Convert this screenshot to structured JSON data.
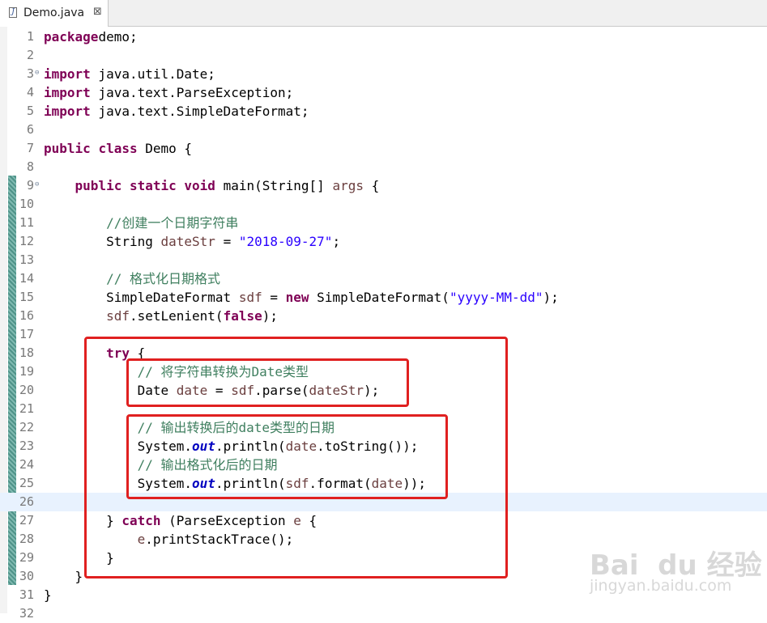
{
  "tab": {
    "filename": "Demo.java",
    "close": "⊠",
    "file_icon": "J"
  },
  "editor": {
    "current_line": 26,
    "lines": [
      {
        "n": "1",
        "fold": false,
        "t": [
          [
            "kw",
            "package"
          ],
          [
            "",
            "demo;"
          ]
        ]
      },
      {
        "n": "2",
        "fold": false,
        "t": []
      },
      {
        "n": "3",
        "fold": true,
        "t": [
          [
            "kw",
            "import"
          ],
          [
            "",
            " java.util.Date;"
          ]
        ]
      },
      {
        "n": "4",
        "fold": false,
        "t": [
          [
            "kw",
            "import"
          ],
          [
            "",
            " java.text.ParseException;"
          ]
        ]
      },
      {
        "n": "5",
        "fold": false,
        "t": [
          [
            "kw",
            "import"
          ],
          [
            "",
            " java.text.SimpleDateFormat;"
          ]
        ]
      },
      {
        "n": "6",
        "fold": false,
        "t": []
      },
      {
        "n": "7",
        "fold": false,
        "t": [
          [
            "kw",
            "public"
          ],
          [
            "",
            " "
          ],
          [
            "kw",
            "class"
          ],
          [
            "",
            " Demo {"
          ]
        ]
      },
      {
        "n": "8",
        "fold": false,
        "t": []
      },
      {
        "n": "9",
        "fold": true,
        "t": [
          [
            "",
            "    "
          ],
          [
            "kw",
            "public"
          ],
          [
            "",
            " "
          ],
          [
            "kw",
            "static"
          ],
          [
            "",
            " "
          ],
          [
            "kw",
            "void"
          ],
          [
            "",
            " main(String[] "
          ],
          [
            "prm",
            "args"
          ],
          [
            "",
            " {"
          ]
        ]
      },
      {
        "n": "10",
        "fold": false,
        "t": []
      },
      {
        "n": "11",
        "fold": false,
        "t": [
          [
            "",
            "        "
          ],
          [
            "cm",
            "//创建一个日期字符串"
          ]
        ]
      },
      {
        "n": "12",
        "fold": false,
        "t": [
          [
            "",
            "        String "
          ],
          [
            "prm",
            "dateStr"
          ],
          [
            "",
            " = "
          ],
          [
            "str",
            "\"2018-09-27\""
          ],
          [
            "",
            ";"
          ]
        ]
      },
      {
        "n": "13",
        "fold": false,
        "t": []
      },
      {
        "n": "14",
        "fold": false,
        "t": [
          [
            "",
            "        "
          ],
          [
            "cm",
            "// 格式化日期格式"
          ]
        ]
      },
      {
        "n": "15",
        "fold": false,
        "t": [
          [
            "",
            "        SimpleDateFormat "
          ],
          [
            "prm",
            "sdf"
          ],
          [
            "",
            " = "
          ],
          [
            "kw",
            "new"
          ],
          [
            "",
            " SimpleDateFormat("
          ],
          [
            "str",
            "\"yyyy-MM-dd\""
          ],
          [
            "",
            ");"
          ]
        ]
      },
      {
        "n": "16",
        "fold": false,
        "t": [
          [
            "",
            "        "
          ],
          [
            "prm",
            "sdf"
          ],
          [
            "",
            ".setLenient("
          ],
          [
            "kw",
            "false"
          ],
          [
            "",
            ");"
          ]
        ]
      },
      {
        "n": "17",
        "fold": false,
        "t": []
      },
      {
        "n": "18",
        "fold": false,
        "t": [
          [
            "",
            "        "
          ],
          [
            "kw",
            "try"
          ],
          [
            "",
            " {"
          ]
        ]
      },
      {
        "n": "19",
        "fold": false,
        "t": [
          [
            "",
            "            "
          ],
          [
            "cm",
            "// 将字符串转换为Date类型"
          ]
        ]
      },
      {
        "n": "20",
        "fold": false,
        "t": [
          [
            "",
            "            Date "
          ],
          [
            "prm",
            "date"
          ],
          [
            "",
            " = "
          ],
          [
            "prm",
            "sdf"
          ],
          [
            "",
            ".parse("
          ],
          [
            "prm",
            "dateStr"
          ],
          [
            "",
            ");"
          ]
        ]
      },
      {
        "n": "21",
        "fold": false,
        "t": []
      },
      {
        "n": "22",
        "fold": false,
        "t": [
          [
            "",
            "            "
          ],
          [
            "cm",
            "// 输出转换后的date类型的日期"
          ]
        ]
      },
      {
        "n": "23",
        "fold": false,
        "t": [
          [
            "",
            "            System."
          ],
          [
            "fld",
            "out"
          ],
          [
            "",
            ".println("
          ],
          [
            "prm",
            "date"
          ],
          [
            "",
            ".toString());"
          ]
        ]
      },
      {
        "n": "24",
        "fold": false,
        "t": [
          [
            "",
            "            "
          ],
          [
            "cm",
            "// 输出格式化后的日期"
          ]
        ]
      },
      {
        "n": "25",
        "fold": false,
        "t": [
          [
            "",
            "            System."
          ],
          [
            "fld",
            "out"
          ],
          [
            "",
            ".println("
          ],
          [
            "prm",
            "sdf"
          ],
          [
            "",
            ".format("
          ],
          [
            "prm",
            "date"
          ],
          [
            "",
            "));"
          ]
        ]
      },
      {
        "n": "26",
        "fold": false,
        "t": []
      },
      {
        "n": "27",
        "fold": false,
        "t": [
          [
            "",
            "        } "
          ],
          [
            "kw",
            "catch"
          ],
          [
            "",
            " (ParseException "
          ],
          [
            "prm",
            "e"
          ],
          [
            "",
            " {"
          ]
        ]
      },
      {
        "n": "28",
        "fold": false,
        "t": [
          [
            "",
            "            "
          ],
          [
            "prm",
            "e"
          ],
          [
            "",
            ".printStackTrace();"
          ]
        ]
      },
      {
        "n": "29",
        "fold": false,
        "t": [
          [
            "",
            "        }"
          ]
        ]
      },
      {
        "n": "30",
        "fold": false,
        "t": [
          [
            "",
            "    }"
          ]
        ]
      },
      {
        "n": "31",
        "fold": false,
        "t": [
          [
            "",
            "}"
          ]
        ]
      },
      {
        "n": "32",
        "fold": false,
        "t": []
      }
    ]
  },
  "watermark": {
    "brand": "Bai  du 经验",
    "url": "jingyan.baidu.com"
  }
}
